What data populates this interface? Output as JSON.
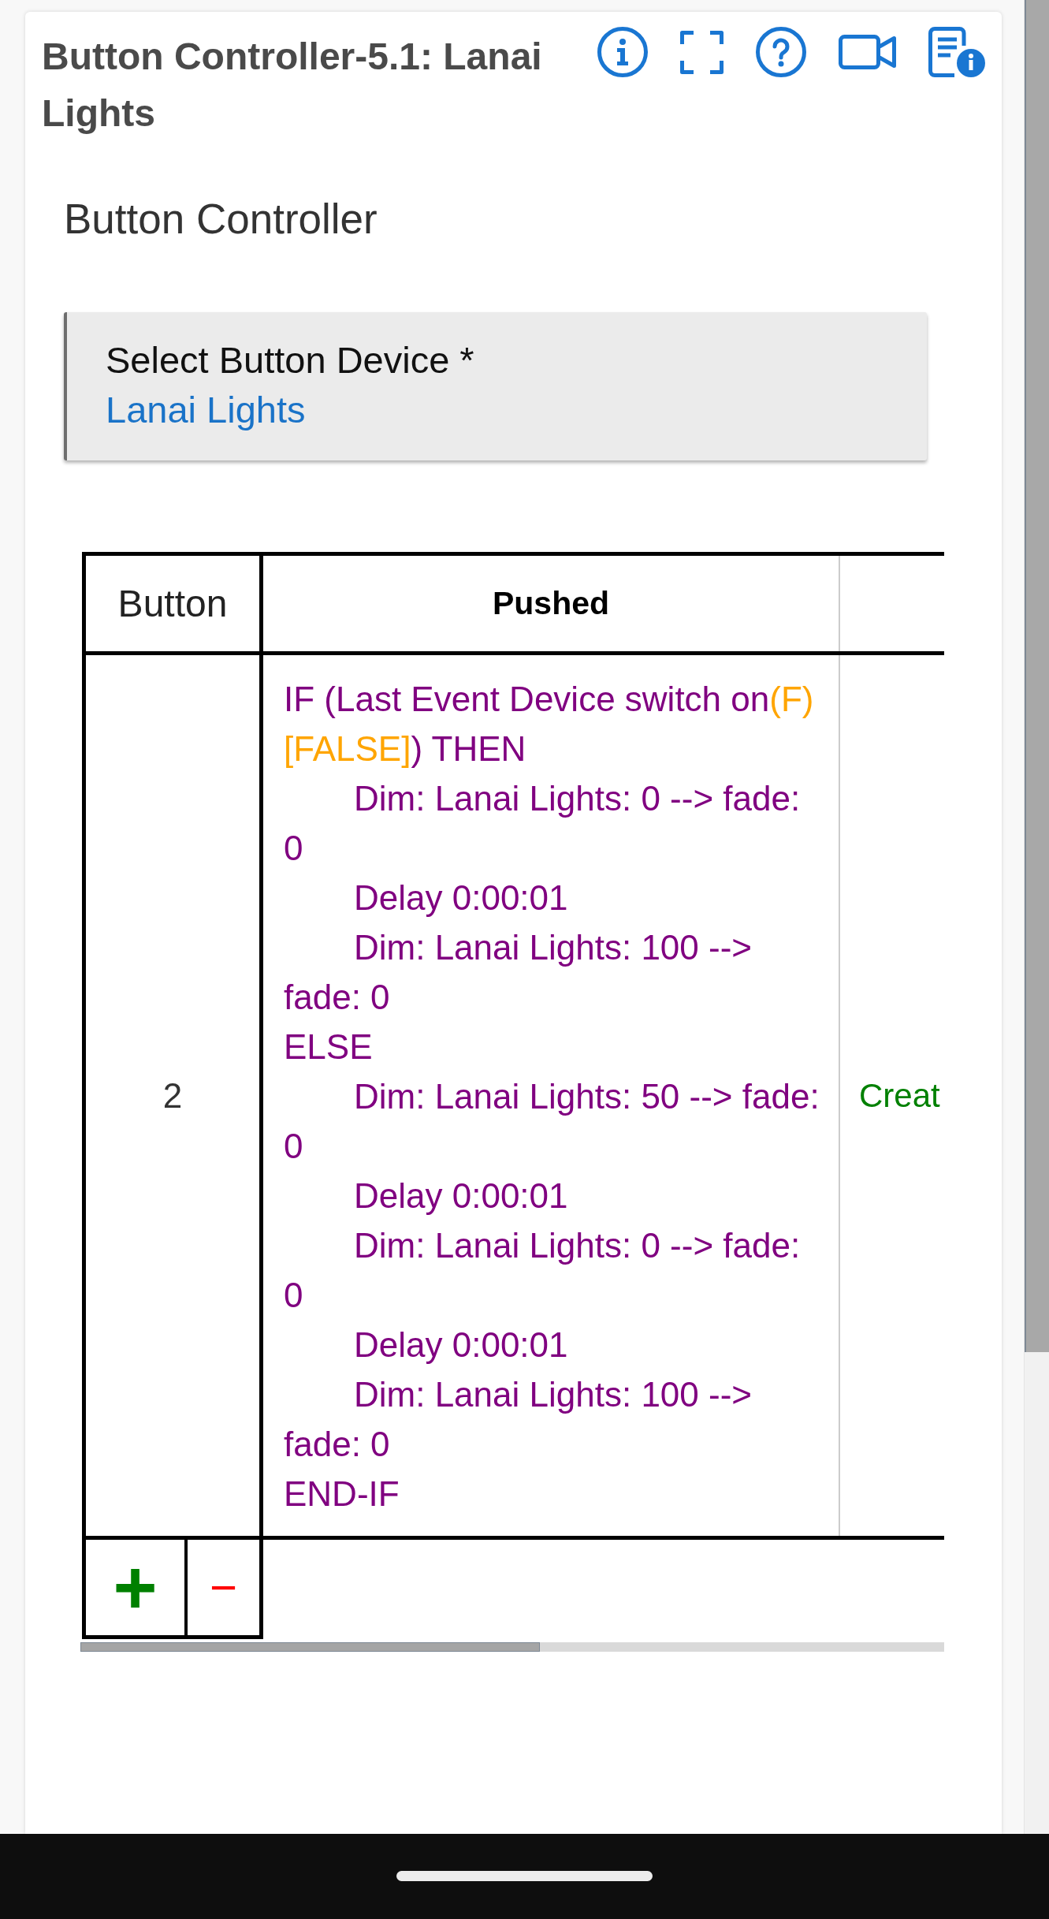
{
  "header": {
    "title": "Button Controller-5.1: Lanai Lights"
  },
  "section": {
    "title": "Button Controller"
  },
  "device_select": {
    "label": "Select Button Device *",
    "value": "Lanai Lights"
  },
  "table": {
    "columns": [
      "Button",
      "Pushed"
    ],
    "rows": [
      {
        "button": "2",
        "pushed": [
          {
            "parts": [
              {
                "kind": "statement",
                "text": "IF (Last Event Device switch on"
              },
              {
                "kind": "evaluation",
                "text": "(F) [FALSE]"
              },
              {
                "kind": "statement",
                "text": ") THEN"
              }
            ],
            "children": [
              {
                "parts": [
                  {
                    "kind": "statement",
                    "text": "Dim: Lanai Lights: 0 --> fade: 0"
                  }
                ]
              },
              {
                "parts": [
                  {
                    "kind": "statement",
                    "text": "Delay 0:00:01"
                  }
                ]
              },
              {
                "parts": [
                  {
                    "kind": "statement",
                    "text": "Dim: Lanai Lights: 100 --> fade: 0"
                  }
                ]
              }
            ]
          },
          {
            "parts": [
              {
                "kind": "statement",
                "text": "ELSE"
              }
            ],
            "children": [
              {
                "parts": [
                  {
                    "kind": "statement",
                    "text": "Dim: Lanai Lights: 50 --> fade: 0"
                  }
                ]
              },
              {
                "parts": [
                  {
                    "kind": "statement",
                    "text": "Delay 0:00:01"
                  }
                ]
              },
              {
                "parts": [
                  {
                    "kind": "statement",
                    "text": "Dim: Lanai Lights: 0 --> fade: 0"
                  }
                ]
              },
              {
                "parts": [
                  {
                    "kind": "statement",
                    "text": "Delay 0:00:01"
                  }
                ]
              },
              {
                "parts": [
                  {
                    "kind": "statement",
                    "text": "Dim: Lanai Lights: 100 --> fade: 0"
                  }
                ]
              }
            ]
          },
          {
            "parts": [
              {
                "kind": "statement",
                "text": "END-IF"
              }
            ]
          }
        ],
        "column_3": "Creat"
      }
    ],
    "row_buttons": [
      {
        "kind": "add",
        "label": "+"
      },
      {
        "kind": "remove",
        "label": "−"
      }
    ]
  }
}
